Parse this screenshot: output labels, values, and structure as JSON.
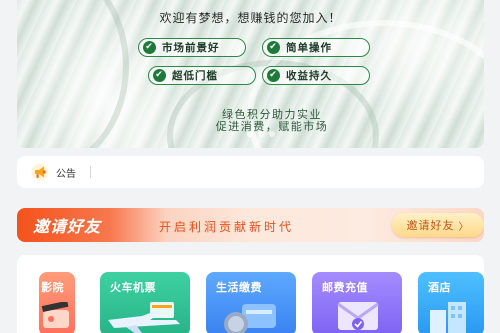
{
  "banner": {
    "welcome": "欢迎有梦想，想赚钱的您加入！",
    "features": [
      {
        "label": "市场前景好"
      },
      {
        "label": "简单操作"
      },
      {
        "label": "超低门槛"
      },
      {
        "label": "收益持久"
      }
    ],
    "slogan_line1": "绿色积分助力实业",
    "slogan_line2": "促进消费，赋能市场",
    "carousel_count": 3
  },
  "notice": {
    "label": "公告",
    "text": ""
  },
  "invite": {
    "title": "邀请好友",
    "slogan": "开启利润贡献新时代",
    "button_label": "邀请好友",
    "button_arrow": "〉"
  },
  "services": [
    {
      "label": "影院",
      "icon": "cinema-icon",
      "color": "#ff7a63"
    },
    {
      "label": "火车机票",
      "icon": "train-plane-icon",
      "color": "#2fbf91"
    },
    {
      "label": "生活缴费",
      "icon": "bill-payment-icon",
      "color": "#4a90f5"
    },
    {
      "label": "邮费充值",
      "icon": "postage-icon",
      "color": "#8a70f5"
    },
    {
      "label": "酒店",
      "icon": "hotel-icon",
      "color": "#3aa8f5"
    }
  ],
  "colors": {
    "accent_green": "#2a8a45",
    "invite_orange": "#f5521b"
  }
}
